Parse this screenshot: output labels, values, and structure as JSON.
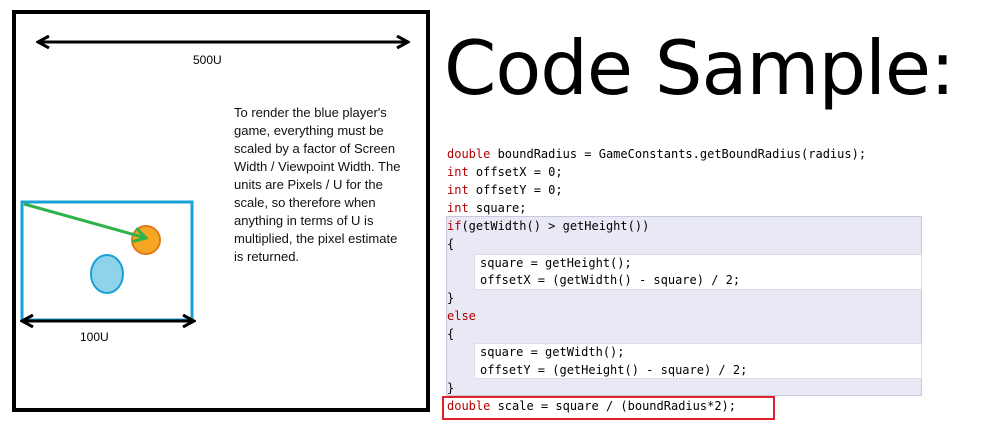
{
  "diagram": {
    "width_label": "500U",
    "viewport_label": "100U",
    "note": "To render the blue player's game, everything must be scaled by a factor of Screen Width / Viewpoint Width. The units are Pixels / U for the scale, so therefore when anything in terms of U is multiplied, the pixel estimate is returned."
  },
  "code": {
    "title": "Code Sample:",
    "lines": [
      {
        "kw": "double",
        "rest": " boundRadius = GameConstants.getBoundRadius(radius);"
      },
      {
        "kw": "int",
        "rest": " offsetX = 0;"
      },
      {
        "kw": "int",
        "rest": " offsetY = 0;"
      },
      {
        "kw": "int",
        "rest": " square;"
      },
      {
        "kw": "if",
        "rest": "(getWidth() > getHeight())"
      },
      {
        "kw": "",
        "rest": "{"
      },
      {
        "kw": "",
        "rest": "square = getHeight();"
      },
      {
        "kw": "",
        "rest": "offsetX = (getWidth() - square) / 2;"
      },
      {
        "kw": "",
        "rest": "}"
      },
      {
        "kw": "else",
        "rest": ""
      },
      {
        "kw": "",
        "rest": "{"
      },
      {
        "kw": "",
        "rest": "square = getWidth();"
      },
      {
        "kw": "",
        "rest": "offsetY = (getHeight() - square) / 2;"
      },
      {
        "kw": "",
        "rest": "}"
      },
      {
        "kw": "double",
        "rest": " scale = square / (boundRadius*2);"
      }
    ]
  },
  "colors": {
    "viewport": "#1aa0d8",
    "blue_player": "#8fd3ea",
    "orange_player": "#f5a623",
    "green_arrow": "#2db34a",
    "highlight": "#e0202a",
    "keyword": "#b00000"
  }
}
